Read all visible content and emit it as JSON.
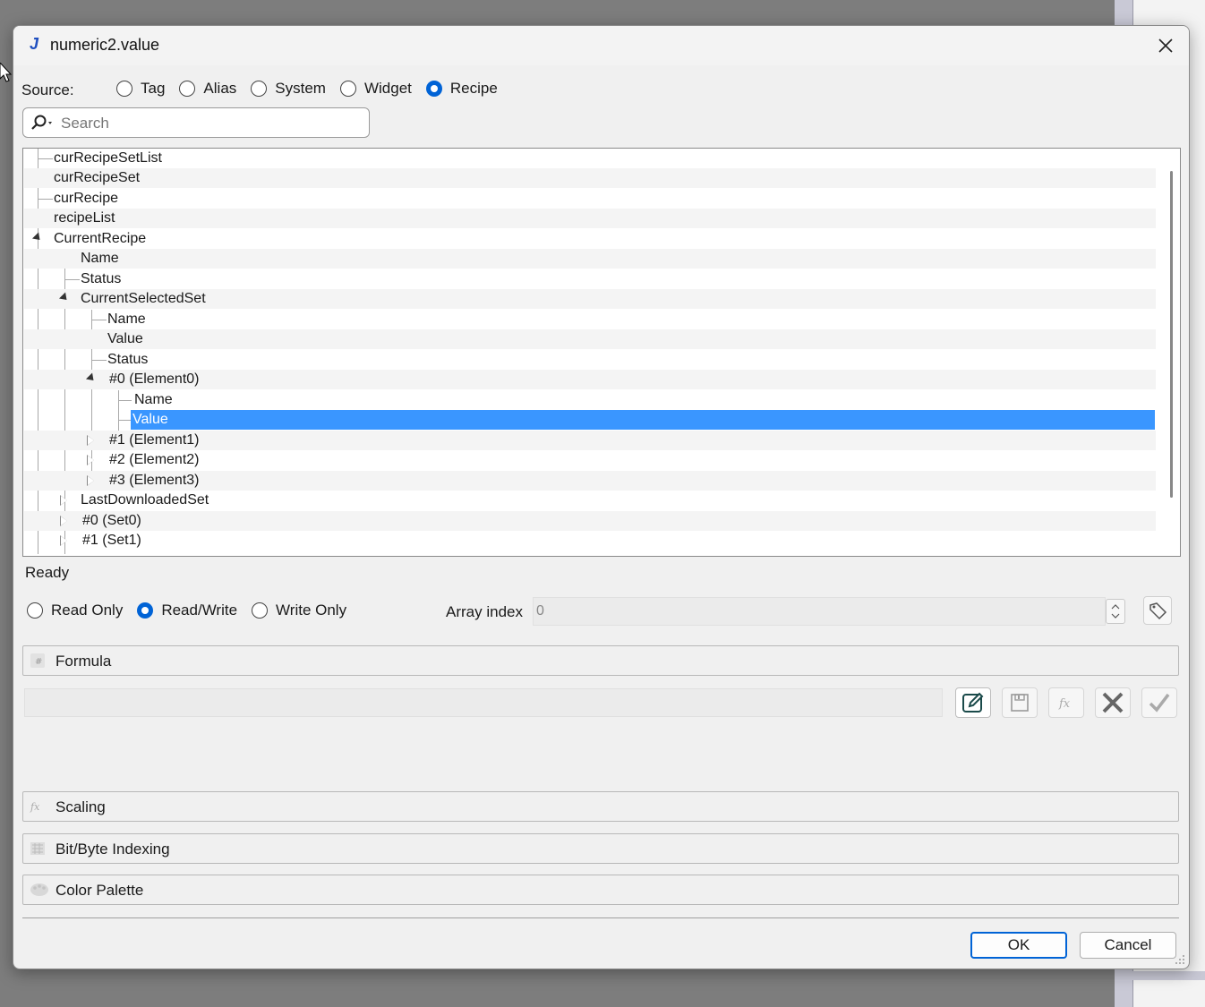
{
  "window": {
    "title": "numeric2.value"
  },
  "source": {
    "label": "Source:",
    "options": [
      "Tag",
      "Alias",
      "System",
      "Widget",
      "Recipe"
    ],
    "selected": "Recipe"
  },
  "search": {
    "placeholder": "Search"
  },
  "tree": {
    "items": [
      "curRecipeSetList",
      "curRecipeSet",
      "curRecipe",
      "recipeList",
      "CurrentRecipe",
      "Name",
      "Status",
      "CurrentSelectedSet",
      "Name",
      "Value",
      "Status",
      "#0 (Element0)",
      "Name",
      "Value",
      "#1 (Element1)",
      "#2 (Element2)",
      "#3 (Element3)",
      "LastDownloadedSet",
      "#0 (Set0)",
      "#1 (Set1)"
    ],
    "selected_item": "Value"
  },
  "status": {
    "text": "Ready"
  },
  "access": {
    "options": [
      "Read Only",
      "Read/Write",
      "Write Only"
    ],
    "selected": "Read/Write"
  },
  "array_index": {
    "label": "Array index",
    "value": "0"
  },
  "sections": {
    "formula": "Formula",
    "scaling": "Scaling",
    "bit_byte": "Bit/Byte Indexing",
    "color_palette": "Color Palette"
  },
  "formula": {
    "value": ""
  },
  "buttons": {
    "ok": "OK",
    "cancel": "Cancel"
  },
  "colors": {
    "accent": "#0063d6",
    "selection": "#3a96ff"
  }
}
